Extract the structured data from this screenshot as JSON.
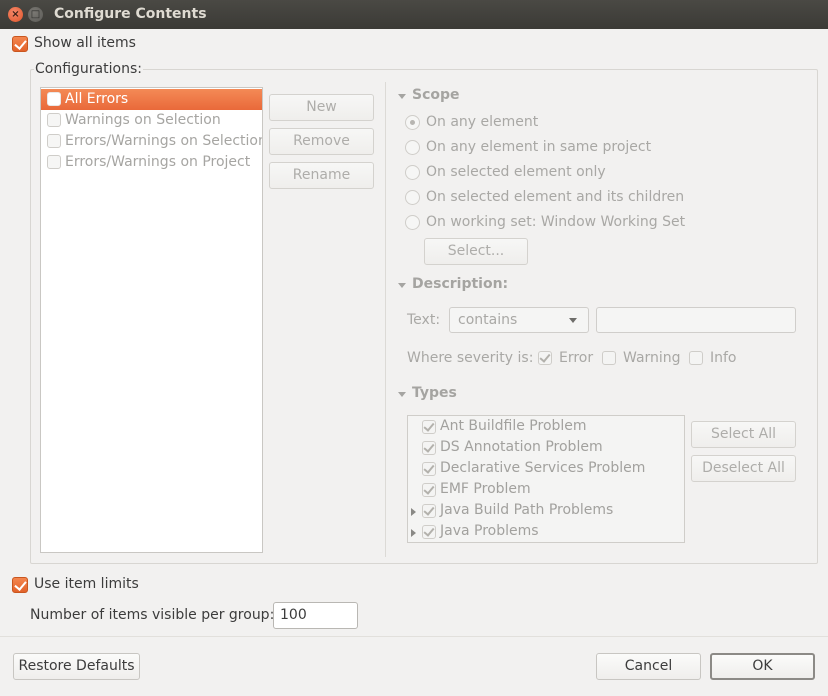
{
  "window": {
    "title": "Configure Contents",
    "close_glyph": "×",
    "maximize_glyph": "□"
  },
  "show_all_items": {
    "label": "Show all items",
    "checked": true
  },
  "configurations": {
    "legend": "Configurations:",
    "items": [
      {
        "label": "All Errors",
        "selected": true,
        "checked": false
      },
      {
        "label": "Warnings on Selection",
        "selected": false,
        "checked": false
      },
      {
        "label": "Errors/Warnings on Selection",
        "selected": false,
        "checked": false
      },
      {
        "label": "Errors/Warnings on Project",
        "selected": false,
        "checked": false
      }
    ],
    "buttons": {
      "new": "New",
      "remove": "Remove",
      "rename": "Rename"
    }
  },
  "scope": {
    "header": "Scope",
    "options": [
      {
        "label": "On any element",
        "selected": true
      },
      {
        "label": "On any element in same project",
        "selected": false
      },
      {
        "label": "On selected element only",
        "selected": false
      },
      {
        "label": "On selected element and its children",
        "selected": false
      },
      {
        "label": "On working set:  Window Working Set",
        "selected": false
      }
    ],
    "select_button": "Select..."
  },
  "description": {
    "header": "Description:",
    "text_label": "Text:",
    "match_mode": "contains",
    "text_value": "",
    "severity_label": "Where severity is:",
    "severities": [
      {
        "label": "Error",
        "checked": true
      },
      {
        "label": "Warning",
        "checked": false
      },
      {
        "label": "Info",
        "checked": false
      }
    ]
  },
  "types": {
    "header": "Types",
    "items": [
      {
        "label": "Ant Buildfile Problem",
        "checked": true,
        "expandable": false
      },
      {
        "label": "DS Annotation Problem",
        "checked": true,
        "expandable": false
      },
      {
        "label": "Declarative Services Problem",
        "checked": true,
        "expandable": false
      },
      {
        "label": "EMF Problem",
        "checked": true,
        "expandable": false
      },
      {
        "label": "Java Build Path Problems",
        "checked": true,
        "expandable": true
      },
      {
        "label": "Java Problems",
        "checked": true,
        "expandable": true
      }
    ],
    "select_all": "Select All",
    "deselect_all": "Deselect All"
  },
  "item_limits": {
    "label": "Use item limits",
    "checked": true,
    "per_group_label": "Number of items visible per group:",
    "per_group_value": "100"
  },
  "footer": {
    "restore_defaults": "Restore Defaults",
    "cancel": "Cancel",
    "ok": "OK"
  },
  "colors": {
    "accent": "#e9693a",
    "titlebar": "#3b3a36",
    "background": "#f2f1f0"
  }
}
